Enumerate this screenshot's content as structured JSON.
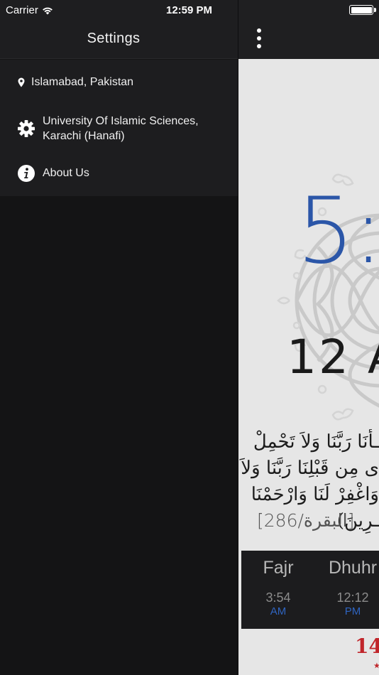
{
  "status_bar": {
    "carrier": "Carrier",
    "time": "12:59 PM"
  },
  "drawer": {
    "title": "Settings",
    "items": [
      {
        "label": "Islamabad, Pakistan",
        "icon": "location-pin-icon"
      },
      {
        "label": "University Of Islamic Sciences, Karachi (Hanafi)",
        "icon": "gear-icon"
      },
      {
        "label": "About Us",
        "icon": "info-icon"
      }
    ]
  },
  "main": {
    "menu_icon": "more-vertical-icon",
    "next_prayer_time": "5:",
    "date": "12 A",
    "verse_lines": [
      "ـأْنَا رَبَّنَا وَلاَ تَحْمِلْ",
      "ى مِن قَبْلِنَا رَبَّنَا وَلاَ",
      "وَاغْفِرْ لَنَا وَارْحَمْنَا",
      "ـرِينَ)"
    ],
    "verse_ref": "[البقرة/286]",
    "prayers": [
      {
        "name": "Fajr",
        "time": "3:54",
        "ampm": "AM"
      },
      {
        "name": "Dhuhr",
        "time": "12:12",
        "ampm": "PM"
      }
    ],
    "hijri_day": "14"
  },
  "colors": {
    "drawer_bg": "#141415",
    "header_bg": "#1e1e20",
    "accent_blue": "#2b56a8",
    "hijri_red": "#c0262b"
  }
}
